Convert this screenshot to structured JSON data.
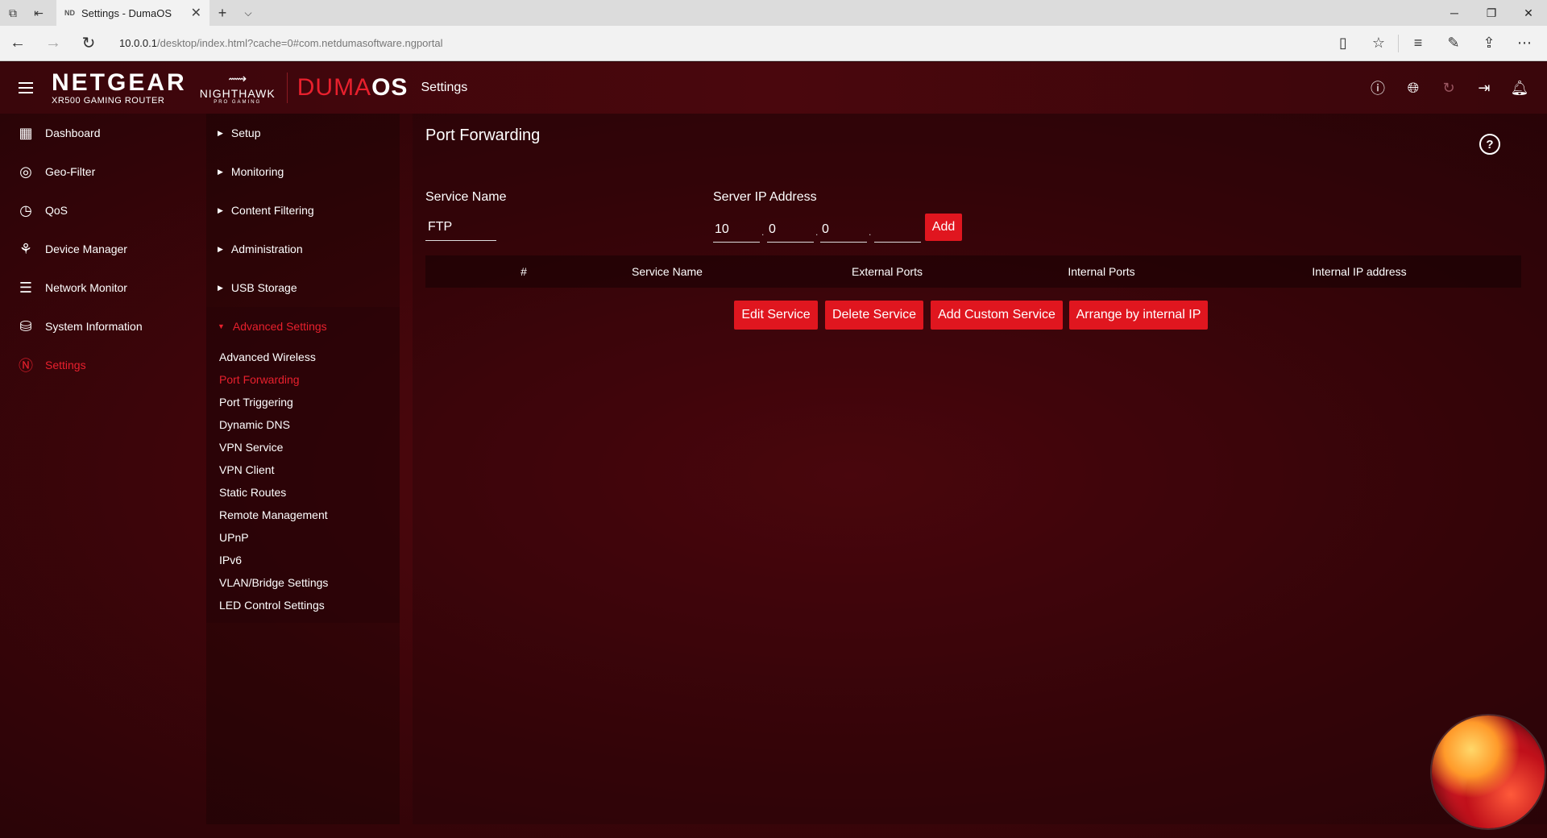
{
  "browser": {
    "tab_title": "Settings - DumaOS",
    "tab_favicon": "ND",
    "url_host": "10.0.0.1",
    "url_path": "/desktop/index.html?cache=0#com.netdumasoftware.ngportal"
  },
  "header": {
    "brand": "NETGEAR",
    "brand_sub": "XR500 GAMING ROUTER",
    "nighthawk": "NIGHTHAWK",
    "nighthawk_sub": "PRO GAMING",
    "duma": "DUMA",
    "os": "OS",
    "title": "Settings"
  },
  "left_nav": [
    {
      "label": "Dashboard",
      "icon": "dashboard-icon",
      "glyph": "▦"
    },
    {
      "label": "Geo-Filter",
      "icon": "geo-filter-icon",
      "glyph": "◎"
    },
    {
      "label": "QoS",
      "icon": "qos-icon",
      "glyph": "◷"
    },
    {
      "label": "Device Manager",
      "icon": "device-manager-icon",
      "glyph": "⚘"
    },
    {
      "label": "Network Monitor",
      "icon": "network-monitor-icon",
      "glyph": "☰"
    },
    {
      "label": "System Information",
      "icon": "system-information-icon",
      "glyph": "⛁"
    },
    {
      "label": "Settings",
      "icon": "settings-icon",
      "glyph": "Ⓝ",
      "active": true
    }
  ],
  "sub_nav": {
    "sections": [
      "Setup",
      "Monitoring",
      "Content Filtering",
      "Administration",
      "USB Storage"
    ],
    "advanced": "Advanced Settings",
    "advanced_items": [
      "Advanced Wireless",
      "Port Forwarding",
      "Port Triggering",
      "Dynamic DNS",
      "VPN Service",
      "VPN Client",
      "Static Routes",
      "Remote Management",
      "UPnP",
      "IPv6",
      "VLAN/Bridge Settings",
      "LED Control Settings"
    ],
    "active_item": "Port Forwarding"
  },
  "content": {
    "title": "Port Forwarding",
    "service_name_label": "Service Name",
    "service_name_value": "FTP",
    "server_ip_label": "Server IP Address",
    "ip": [
      "10",
      "0",
      "0",
      ""
    ],
    "add_label": "Add",
    "table_headers": [
      "#",
      "Service Name",
      "External Ports",
      "Internal Ports",
      "Internal IP address"
    ],
    "buttons": [
      "Edit Service",
      "Delete Service",
      "Add Custom Service",
      "Arrange by internal IP"
    ]
  },
  "colors": {
    "accent": "#e8202d",
    "background": "#3e050a"
  }
}
